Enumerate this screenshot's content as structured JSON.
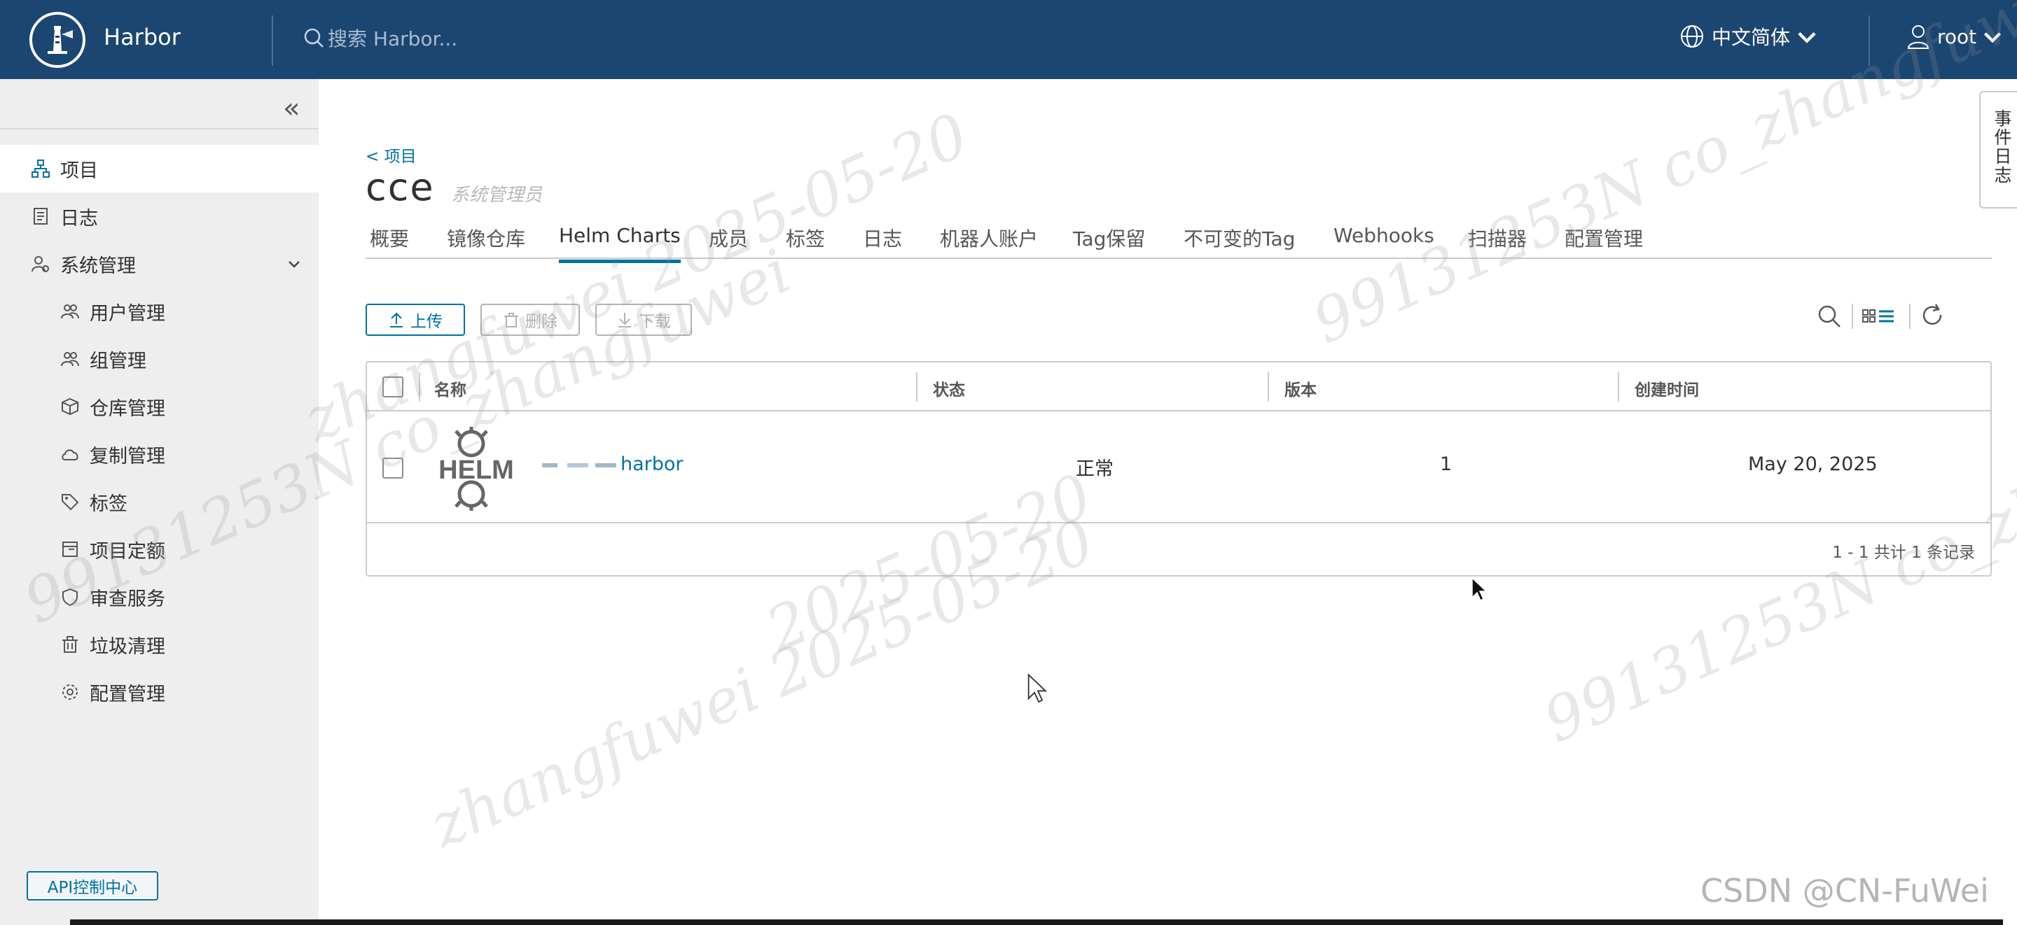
{
  "header": {
    "brand": "Harbor",
    "search_placeholder": "搜索 Harbor...",
    "language": "中文简体",
    "user": "root"
  },
  "sidebar": {
    "items": [
      {
        "label": "项目",
        "icon": "projects-icon",
        "active": true
      },
      {
        "label": "日志",
        "icon": "logs-icon"
      },
      {
        "label": "系统管理",
        "icon": "admin-icon",
        "expandable": true
      },
      {
        "label": "用户管理",
        "icon": "users-icon"
      },
      {
        "label": "组管理",
        "icon": "groups-icon"
      },
      {
        "label": "仓库管理",
        "icon": "registry-icon"
      },
      {
        "label": "复制管理",
        "icon": "replication-icon"
      },
      {
        "label": "标签",
        "icon": "tag-icon"
      },
      {
        "label": "项目定额",
        "icon": "quota-icon"
      },
      {
        "label": "审查服务",
        "icon": "shield-icon"
      },
      {
        "label": "垃圾清理",
        "icon": "trash-icon"
      },
      {
        "label": "配置管理",
        "icon": "gear-icon"
      }
    ],
    "api_button": "API控制中心"
  },
  "project": {
    "back_link": "< 项目",
    "name": "cce",
    "role": "系统管理员"
  },
  "tabs": [
    "概要",
    "镜像仓库",
    "Helm Charts",
    "成员",
    "标签",
    "日志",
    "机器人账户",
    "Tag保留",
    "不可变的Tag",
    "Webhooks",
    "扫描器",
    "配置管理"
  ],
  "active_tab": "Helm Charts",
  "toolbar": {
    "upload": "上传",
    "delete": "删除",
    "download": "下载"
  },
  "table": {
    "columns": [
      "名称",
      "状态",
      "版本",
      "创建时间"
    ],
    "rows": [
      {
        "logo": "HELM",
        "name": "harbor",
        "status": "正常",
        "versions": "1",
        "created": "May 20, 2025"
      }
    ],
    "footer": "1 - 1 共计 1 条记录"
  },
  "event_log": "事件日志",
  "watermarks": {
    "text_a": "zhangfuwei 2025-05-20",
    "text_b": "99131253N co_zhangfuwei",
    "text_c": "2025-05-20",
    "csdn": "CSDN @CN-FuWei"
  },
  "colors": {
    "header_bg": "#1b4672",
    "accent": "#0072a3",
    "sidebar_bg": "#eeeeee"
  }
}
